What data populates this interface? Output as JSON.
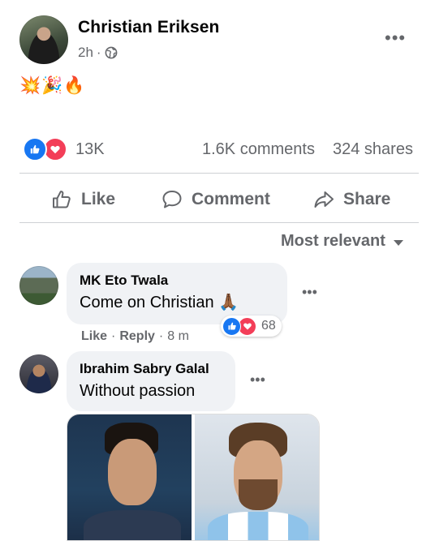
{
  "post": {
    "author": "Christian Eriksen",
    "time": "2h",
    "separator": "·",
    "emojis": "💥🎉🔥"
  },
  "stats": {
    "reactions": "13K",
    "comments": "1.6K comments",
    "shares": "324 shares"
  },
  "actions": {
    "like": "Like",
    "comment": "Comment",
    "share": "Share"
  },
  "sort": {
    "label": "Most relevant"
  },
  "comments": [
    {
      "name": "MK Eto Twala",
      "text": "Come on Christian 🙏🏾",
      "like": "Like",
      "reply": "Reply",
      "time": "8 m",
      "reaction_count": "68"
    },
    {
      "name": "Ibrahim Sabry Galal",
      "text": "Without passion"
    }
  ],
  "icons": {
    "more": "more-options-icon",
    "globe": "globe-icon",
    "like": "thumbs-up-icon",
    "love": "heart-icon",
    "comment": "comment-icon",
    "share": "share-icon",
    "caret": "caret-down-icon"
  },
  "colors": {
    "like_blue": "#1877f2",
    "love_red": "#f33e58",
    "muted_text": "#65676b",
    "bubble_bg": "#f0f2f5"
  }
}
